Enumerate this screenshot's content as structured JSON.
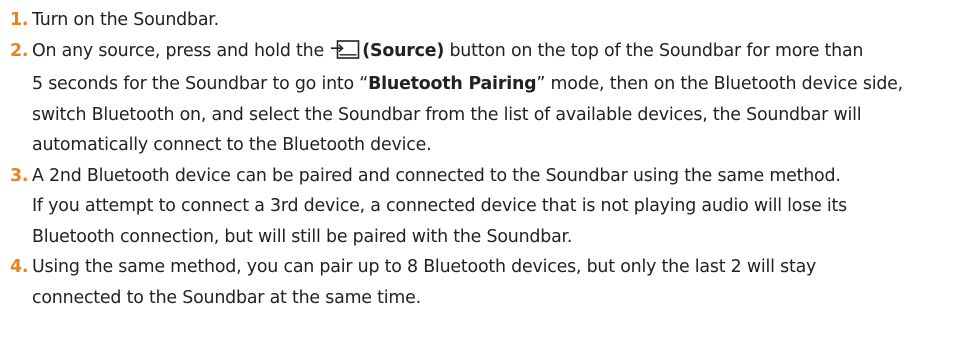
{
  "accent_color": "#E8831E",
  "steps": [
    {
      "number": "1.",
      "text": "Turn on the Soundbar."
    },
    {
      "number": "2.",
      "pre_icon": "On any source, press and hold the ",
      "icon": "source-icon",
      "button_name": "(Source)",
      "line1_rest": " button on the top of the Soundbar for more than",
      "line2_pre": "5 seconds for the Soundbar to go into “",
      "mode_name": "Bluetooth Pairing",
      "line2_post": "” mode, then on the Bluetooth device side,",
      "line3": "switch Bluetooth on, and select the Soundbar from the list of available devices, the Soundbar will",
      "line4": "automatically connect to the Bluetooth device."
    },
    {
      "number": "3.",
      "line1": "A 2nd Bluetooth device can be paired and connected to the Soundbar using the same method.",
      "line2": "If you attempt to connect a 3rd device, a connected device that is not playing audio will lose its",
      "line3": "Bluetooth connection, but will still be paired with the Soundbar."
    },
    {
      "number": "4.",
      "line1": "Using the same method, you can pair up to 8 Bluetooth devices, but only the last 2 will stay",
      "line2": "connected to the Soundbar at the same time."
    }
  ]
}
